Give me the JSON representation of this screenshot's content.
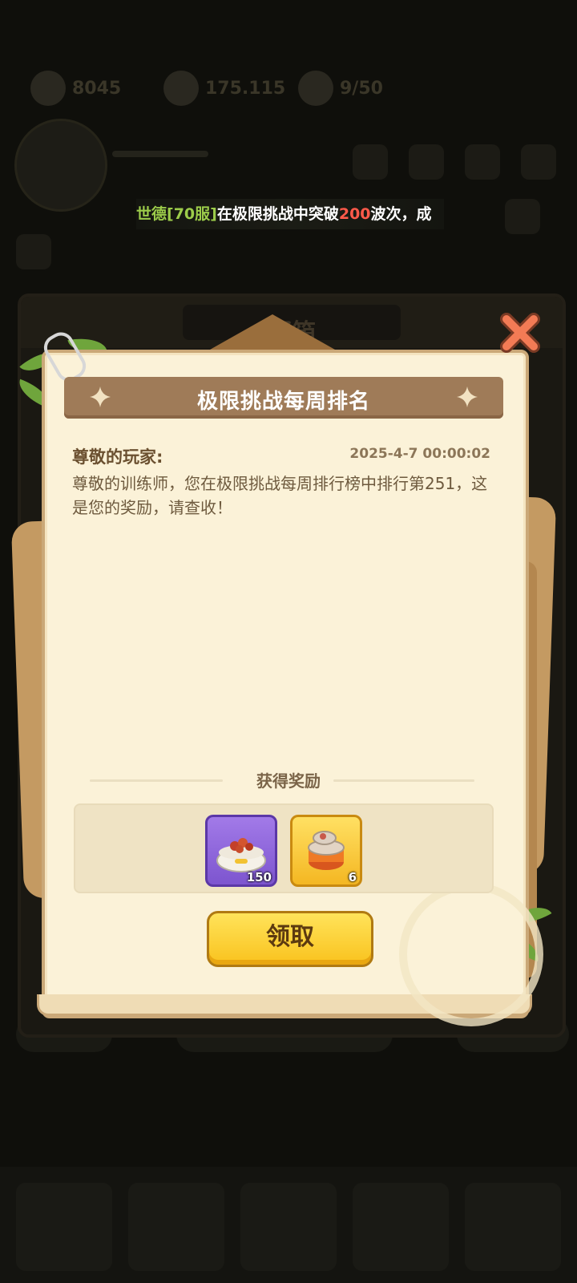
{
  "background": {
    "resources": [
      {
        "name": "stamina",
        "value": "8045"
      },
      {
        "name": "gold",
        "value": "175.115"
      },
      {
        "name": "pets",
        "value": "9/50"
      }
    ],
    "ticker": {
      "prefix": "世德",
      "server": "[70服]",
      "text1": "在极限挑战中突破",
      "waves": "200",
      "text2": "波次，成"
    }
  },
  "mailbox": {
    "title": "邮箱"
  },
  "mail": {
    "title": "极限挑战每周排名",
    "greeting": "尊敬的玩家:",
    "date": "2025-4-7 00:00:02",
    "body": "尊敬的训练师，您在极限挑战每周排行榜中排行第251，这是您的奖励，请查收！",
    "rewards_label": "获得奖励",
    "rewards": [
      {
        "icon": "pet-food-bowl-icon",
        "count": "150",
        "rarity": "epic",
        "color": "#8e63dd"
      },
      {
        "icon": "canned-food-icon",
        "count": "6",
        "rarity": "legendary",
        "color": "#f7c531"
      }
    ],
    "claim_label": "领取"
  },
  "colors": {
    "paper": "#fbf2d8",
    "banner": "#9f7b58",
    "claim_button": "#f9c21d",
    "close_button": "#f07050"
  }
}
